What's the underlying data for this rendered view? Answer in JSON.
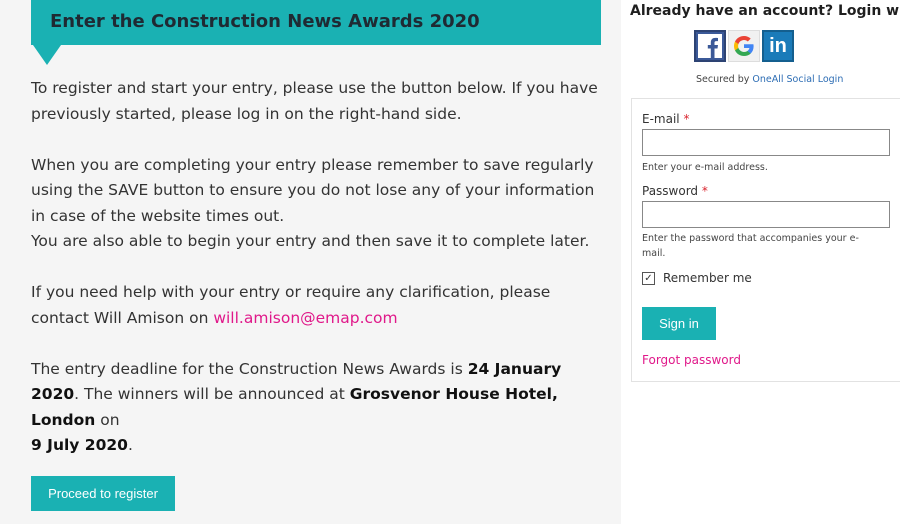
{
  "banner": {
    "title": "Enter the Construction News Awards 2020"
  },
  "content": {
    "p1": "To register and start your entry, please use the button below.  If you have previously started, please log in on the right-hand side.",
    "p2a": "When you are completing your entry please remember to save regularly using the SAVE button to ensure you do not lose any of your information in case of the website times out.",
    "p2b": "You are also able to begin your entry and then save it to complete later.",
    "p3_text": "If you need help with your entry or require any clarification, please contact Will Amison on ",
    "p3_email": "will.amison@emap.com",
    "p4_t1": "The entry deadline for the Construction News Awards is ",
    "p4_b1": "24 January 2020",
    "p4_t2": ". The winners will be announced at ",
    "p4_b2": "Grosvenor House Hotel, London",
    "p4_t3": " on ",
    "p4_b3": "9 July 2020",
    "p4_t4": "."
  },
  "register_button": "Proceed to register",
  "social": {
    "heading": "Already have an account? Login with",
    "icons": [
      "facebook-icon",
      "google-icon",
      "linkedin-icon"
    ],
    "secured_text": "Secured by ",
    "secured_link": "OneAll Social Login"
  },
  "login": {
    "email_label": "E-mail",
    "email_hint": "Enter your e-mail address.",
    "password_label": "Password",
    "password_hint": "Enter the password that accompanies your e-mail.",
    "required_mark": "*",
    "remember_label": "Remember me",
    "remember_checked": true,
    "signin_label": "Sign in",
    "forgot_label": "Forgot password"
  },
  "colors": {
    "accent": "#1ab1b3",
    "link": "#e0198a",
    "required": "#d9232d"
  }
}
